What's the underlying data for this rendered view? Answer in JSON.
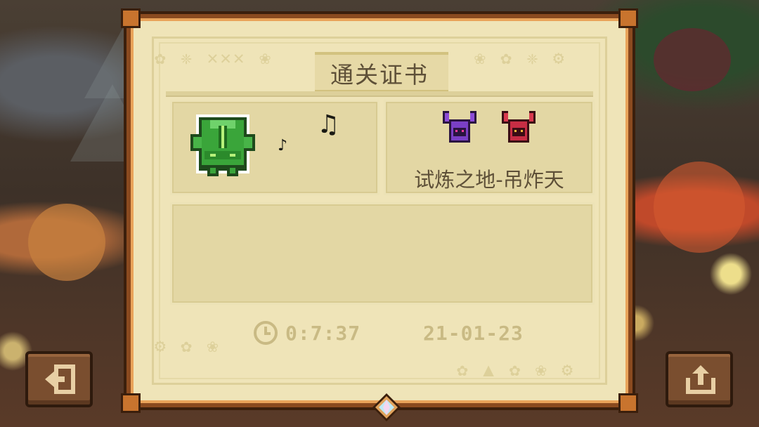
{
  "certificate": {
    "title": "通关证书",
    "stage_name": "试炼之地-吊炸天",
    "time": "0:7:37",
    "date": "21-01-23"
  },
  "icons": {
    "back": "exit-icon",
    "share": "share-icon",
    "clock": "clock-icon",
    "hero": "green-robot-hero-icon",
    "music": "music-note-icon",
    "boss1": "purple-demon-icon",
    "boss2": "red-demon-icon",
    "gem": "diamond-gem-icon"
  },
  "colors": {
    "paper": "#efe4b8",
    "frame": "#8a4a1f",
    "text": "#5e5038",
    "faded_text": "#c9ba84",
    "button": "#7a4e2f"
  }
}
